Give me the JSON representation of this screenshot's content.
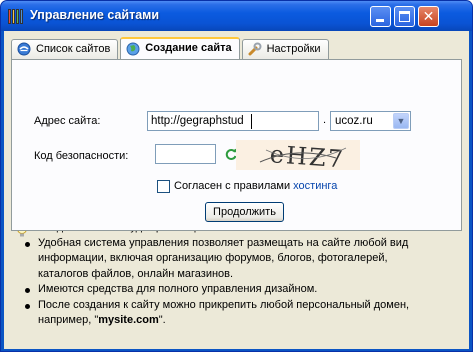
{
  "window": {
    "title": "Управление сайтами"
  },
  "tabs": [
    {
      "label": "Список сайтов",
      "icon": "globe-ie-icon",
      "active": false
    },
    {
      "label": "Создание сайта",
      "icon": "globe-icon",
      "active": true
    },
    {
      "label": "Настройки",
      "icon": "wrench-icon",
      "active": false
    }
  ],
  "form": {
    "address_label": "Адрес сайта:",
    "address_value": "http://gegraphstud",
    "domain_separator": ".",
    "domain_value": "ucoz.ru",
    "security_label": "Код безопасности:",
    "security_value": "",
    "captcha_text": "eHZ7",
    "agree_text": "Согласен с правилами",
    "agree_link": "хостинга",
    "agree_checked": false,
    "continue_label": "Продолжить"
  },
  "info": {
    "items": [
      "Созданный сайт будет размещен на бесплатном Веб-хостинге.",
      "Удобная система управления позволяет размещать на сайте любой вид информации, включая организацию форумов, блогов, фотогалерей, каталогов файлов, онлайн магазинов.",
      "Имеются средства для полного управления дизайном."
    ],
    "last_item_prefix": "После создания к сайту можно прикрепить любой персональный домен, например, \"",
    "last_item_bold": "mysite.com",
    "last_item_suffix": "\"."
  },
  "colors": {
    "titlebar": "#0b5be0",
    "link": "#0645ad",
    "active_tab_accent": "#ffc83c"
  }
}
